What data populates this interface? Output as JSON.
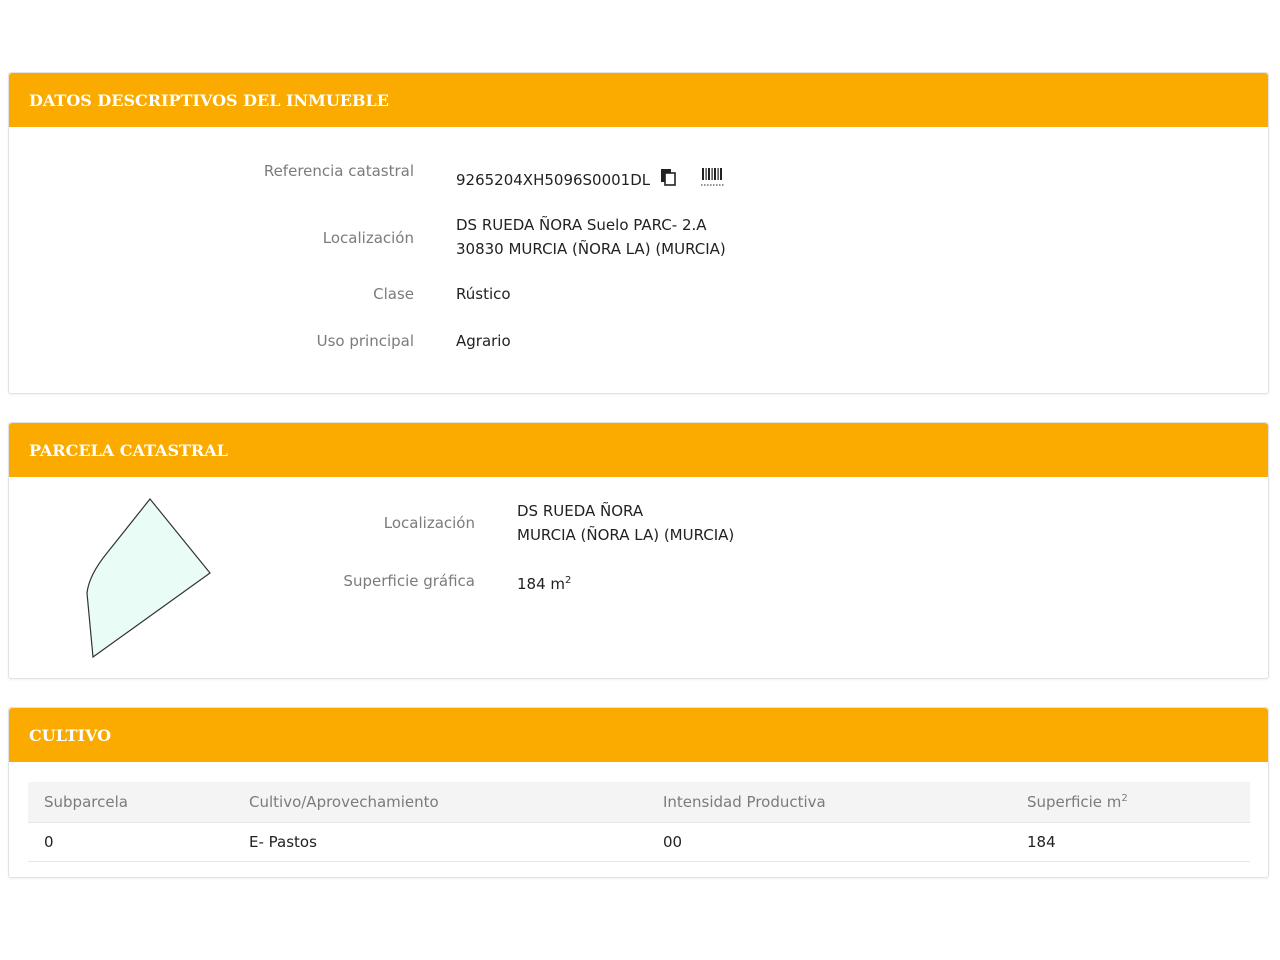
{
  "panel1": {
    "title": "DATOS DESCRIPTIVOS DEL INMUEBLE",
    "ref_label": "Referencia catastral",
    "ref_value": "9265204XH5096S0001DL",
    "loc_label": "Localización",
    "loc_line1": "DS RUEDA ÑORA Suelo PARC- 2.A",
    "loc_line2": "30830 MURCIA (ÑORA LA) (MURCIA)",
    "clase_label": "Clase",
    "clase_value": "Rústico",
    "uso_label": "Uso principal",
    "uso_value": "Agrario",
    "icons": [
      "copy-icon",
      "barcode-icon"
    ]
  },
  "panel2": {
    "title": "PARCELA CATASTRAL",
    "loc_label": "Localización",
    "loc_line1": "DS RUEDA ÑORA",
    "loc_line2": "MURCIA (ÑORA LA) (MURCIA)",
    "sup_label": "Superficie gráfica",
    "sup_value": "184 m",
    "sup_exp": "2",
    "parcel_fill": "#e9fdf6"
  },
  "panel3": {
    "title": "CULTIVO",
    "headers": [
      "Subparcela",
      "Cultivo/Aprovechamiento",
      "Intensidad Productiva",
      "Superficie m"
    ],
    "header_exp": "2",
    "rows": [
      [
        "0",
        "E- Pastos",
        "00",
        "184"
      ]
    ]
  },
  "colors": {
    "accent": "#fbab00"
  }
}
